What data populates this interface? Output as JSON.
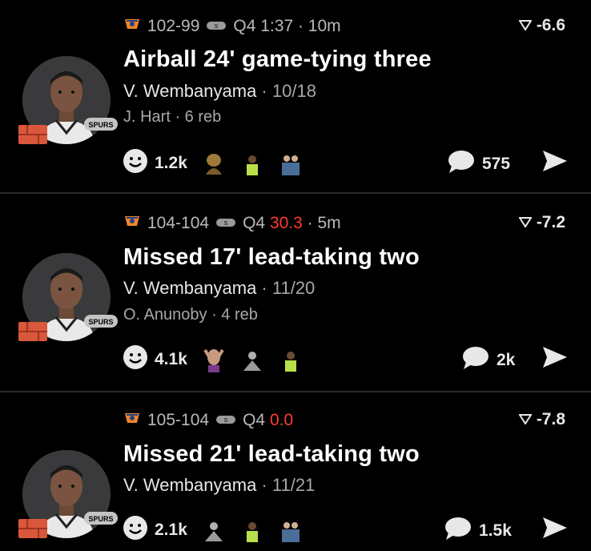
{
  "plays": [
    {
      "score": "102-99",
      "clock_prefix": "Q4",
      "clock": "1:37",
      "clock_red": false,
      "ago": "10m",
      "wp_delta": "-6.6",
      "title": "Airball 24' game-tying three",
      "player": "V. Wembanyama",
      "stat": "10/18",
      "secondary": "J. Hart · 6 reb",
      "reactions": "1.2k",
      "comments": "575"
    },
    {
      "score": "104-104",
      "clock_prefix": "Q4",
      "clock": "30.3",
      "clock_red": true,
      "ago": "5m",
      "wp_delta": "-7.2",
      "title": "Missed 17' lead-taking two",
      "player": "V. Wembanyama",
      "stat": "11/20",
      "secondary": "O. Anunoby · 4 reb",
      "reactions": "4.1k",
      "comments": "2k"
    },
    {
      "score": "105-104",
      "clock_prefix": "Q4",
      "clock": "0.0",
      "clock_red": true,
      "ago": "",
      "wp_delta": "-7.8",
      "title": "Missed 21' lead-taking two",
      "player": "V. Wembanyama",
      "stat": "11/21",
      "secondary": "",
      "reactions": "2.1k",
      "comments": "1.5k"
    }
  ],
  "team_chip_text": "SPURS",
  "colors": {
    "background": "#000000",
    "text_muted": "#b9b9b9",
    "clock_red": "#ff3b30",
    "divider": "#2a2a2a"
  }
}
